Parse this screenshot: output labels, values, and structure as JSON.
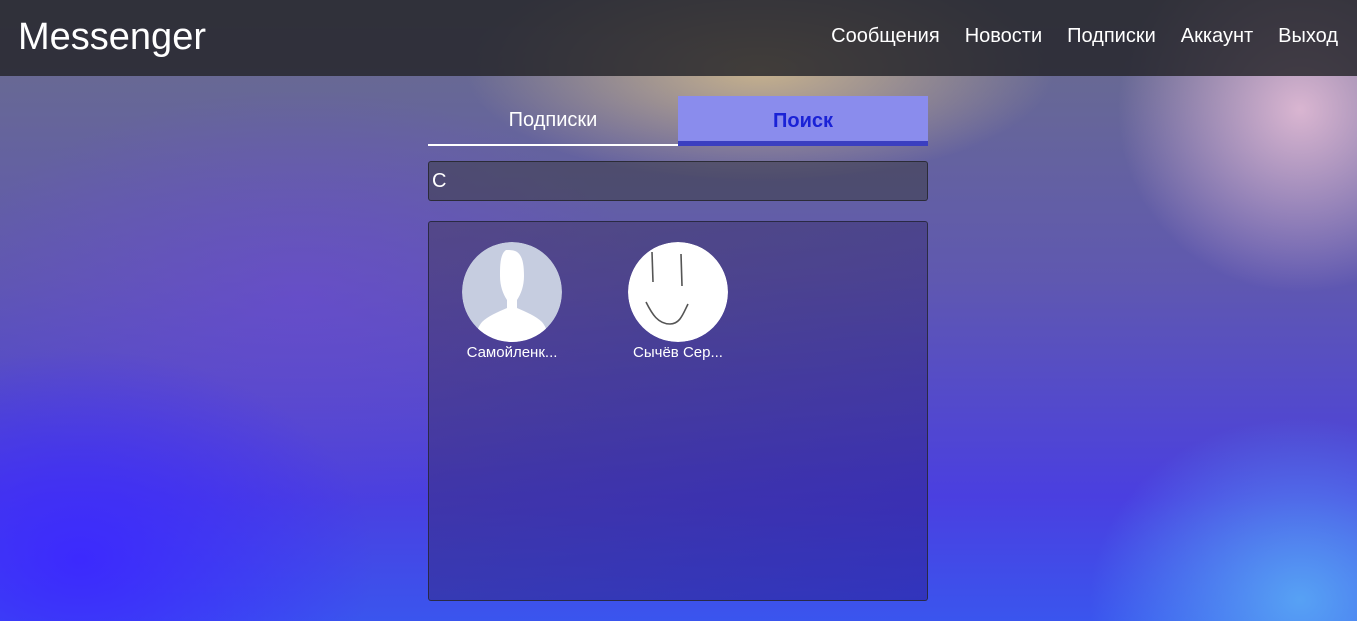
{
  "header": {
    "brand": "Messenger",
    "nav": [
      "Сообщения",
      "Новости",
      "Подписки",
      "Аккаунт",
      "Выход"
    ]
  },
  "tabs": [
    {
      "label": "Подписки",
      "active": false
    },
    {
      "label": "Поиск",
      "active": true
    }
  ],
  "search": {
    "value": "С"
  },
  "results": [
    {
      "name": "Самойленк...",
      "avatar_icon": "default-silhouette-avatar"
    },
    {
      "name": "Сычёв Сер...",
      "avatar_icon": "drawn-face-avatar"
    }
  ],
  "colors": {
    "active_tab_bg": "#8a8ced",
    "active_tab_text": "#1a22d6",
    "active_tab_border": "#3b3fc0"
  }
}
